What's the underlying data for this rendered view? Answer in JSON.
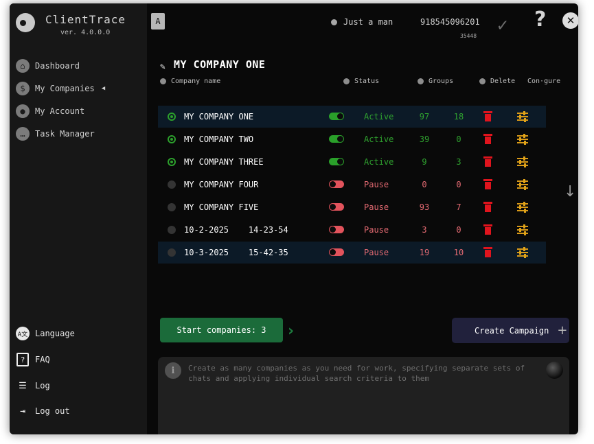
{
  "app": {
    "title": "ClientTrace",
    "version": "ver. 4.0.0.0"
  },
  "sidebar": {
    "nav": [
      {
        "label": "Dashboard",
        "icon": "home-icon"
      },
      {
        "label": "My Companies",
        "icon": "dollar-icon"
      },
      {
        "label": "My Account",
        "icon": "user-icon"
      },
      {
        "label": "Task Manager",
        "icon": "chat-icon"
      }
    ],
    "bottom": [
      {
        "label": "Language",
        "icon": "language-icon"
      },
      {
        "label": "FAQ",
        "icon": "faq-icon"
      },
      {
        "label": "Log",
        "icon": "list-icon"
      },
      {
        "label": "Log out",
        "icon": "logout-icon"
      }
    ]
  },
  "topbar": {
    "user_name": "Just a man",
    "user_id": "918545096201",
    "user_sub": "35448",
    "book_icon_letter": "A"
  },
  "page": {
    "title": "MY COMPANY ONE",
    "headers": {
      "name": "Company name",
      "status": "Status",
      "groups": "Groups",
      "delete": "Delete",
      "configure": "Con·gure"
    }
  },
  "companies": [
    {
      "name": "MY COMPANY ONE",
      "selected": true,
      "enabled": true,
      "status": "Active",
      "groups": "97",
      "groups2": "18",
      "highlighted": true
    },
    {
      "name": "MY COMPANY TWO",
      "selected": true,
      "enabled": true,
      "status": "Active",
      "groups": "39",
      "groups2": "0",
      "highlighted": false
    },
    {
      "name": "MY COMPANY THREE",
      "selected": true,
      "enabled": true,
      "status": "Active",
      "groups": "9",
      "groups2": "3",
      "highlighted": false
    },
    {
      "name": "MY COMPANY FOUR",
      "selected": false,
      "enabled": false,
      "status": "Pause",
      "groups": "0",
      "groups2": "0",
      "highlighted": false
    },
    {
      "name": "MY COMPANY FIVE",
      "selected": false,
      "enabled": false,
      "status": "Pause",
      "groups": "93",
      "groups2": "7",
      "highlighted": false
    },
    {
      "name": "10-2-2025    14-23-54",
      "selected": false,
      "enabled": false,
      "status": "Pause",
      "groups": "3",
      "groups2": "0",
      "highlighted": false
    },
    {
      "name": "10-3-2025    15-42-35",
      "selected": false,
      "enabled": false,
      "status": "Pause",
      "groups": "19",
      "groups2": "10",
      "highlighted": true
    }
  ],
  "actions": {
    "start_label": "Start companies: 3",
    "create_label": "Create Campaign"
  },
  "info": {
    "text": "Create as many companies as you need for work, specifying separate sets of chats and applying individual search criteria to them"
  },
  "colors": {
    "active": "#2fa22f",
    "pause": "#e46a72",
    "start": "#1b6b3a",
    "create": "#21213c",
    "trash": "#e0141d",
    "configure": "#d99a18"
  }
}
